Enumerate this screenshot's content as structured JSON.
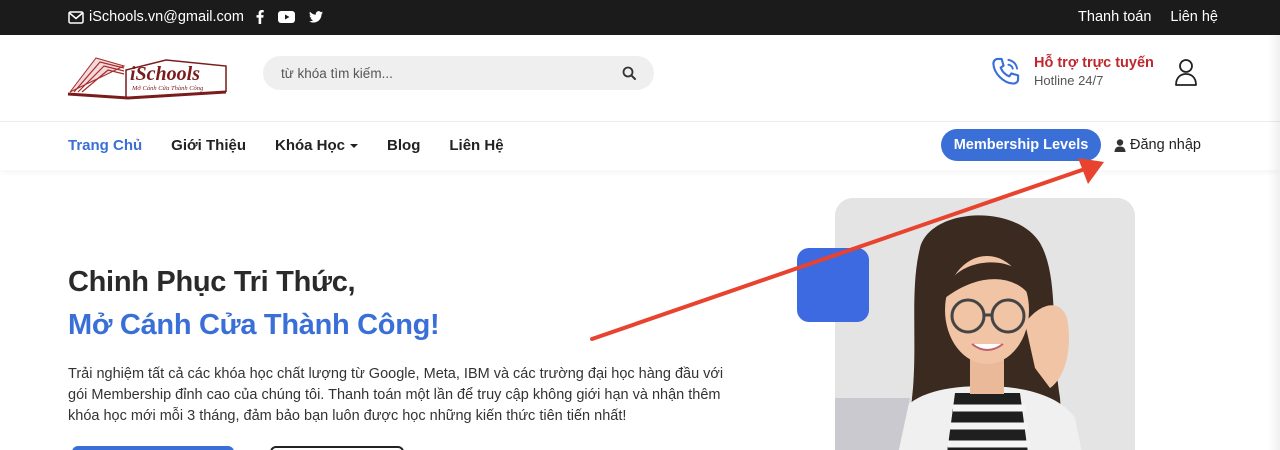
{
  "topbar": {
    "email": "iSchools.vn@gmail.com",
    "links": [
      "Thanh toán",
      "Liên hệ"
    ]
  },
  "header": {
    "logo_text": "iSchools",
    "logo_tagline": "Mở Cánh Cửa Thành Công",
    "search_placeholder": "từ khóa tìm kiếm...",
    "support_title": "Hỗ trợ trực tuyến",
    "support_sub": "Hotline 24/7"
  },
  "nav": {
    "items": [
      "Trang Chủ",
      "Giới Thiệu",
      "Khóa Học",
      "Blog",
      "Liên Hệ"
    ],
    "membership": "Membership Levels",
    "login": "Đăng nhập"
  },
  "hero": {
    "title_line1": "Chinh Phục Tri Thức,",
    "title_line2": "Mở Cánh Cửa Thành Công!",
    "description": "Trải nghiệm tất cả các khóa học chất lượng từ Google, Meta, IBM và các trường đại học hàng đầu với gói Membership đỉnh cao của chúng tôi. Thanh toán một lần để truy cập không giới hạn và nhận thêm khóa học mới mỗi 3 tháng, đảm bảo bạn luôn được học những kiến thức tiên tiến nhất!"
  },
  "colors": {
    "accent": "#3a6fd8",
    "support_red": "#c0262d",
    "topbar_bg": "#1b1b1b",
    "annotation_arrow": "#e8432e"
  },
  "icons": [
    "mail-icon",
    "facebook-icon",
    "youtube-icon",
    "twitter-icon",
    "search-icon",
    "phone-icon",
    "user-icon",
    "user-solid-icon"
  ]
}
